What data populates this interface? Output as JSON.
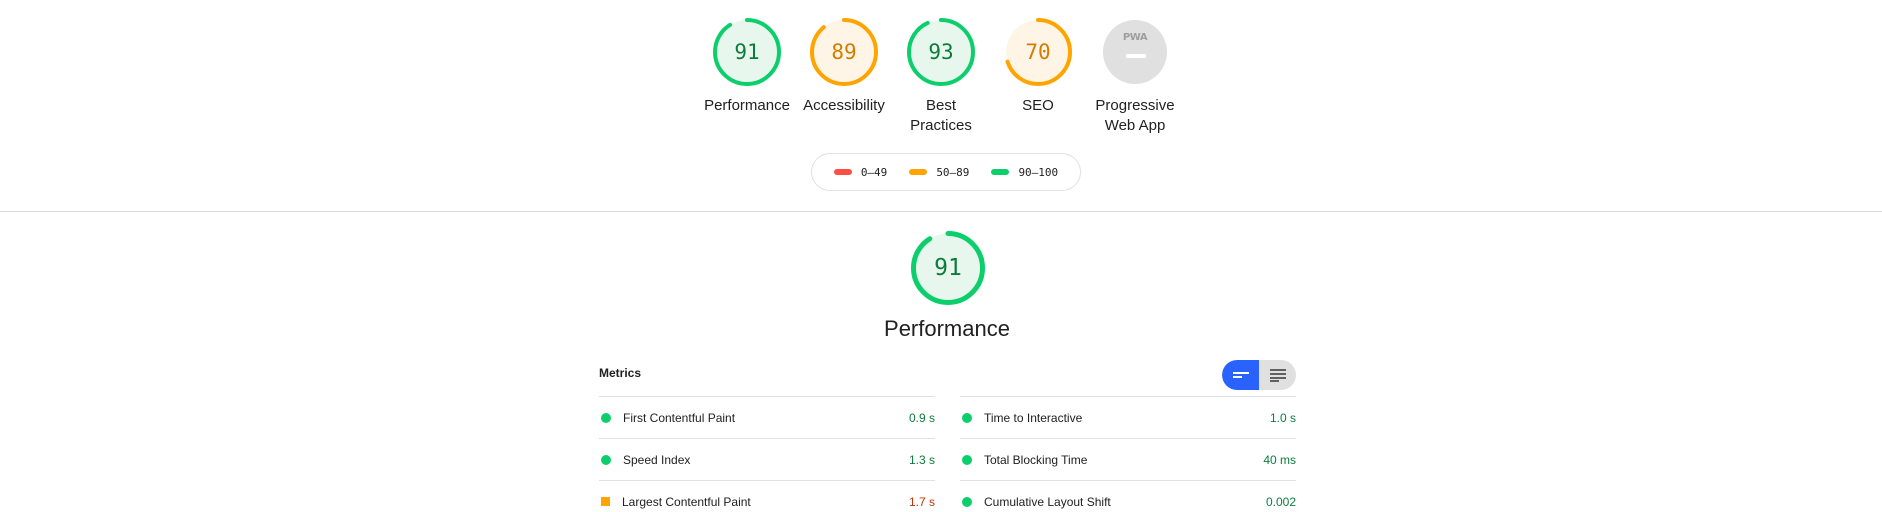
{
  "colors": {
    "pass": "#0cce6b",
    "pass_text": "#0c7c3d",
    "pass_bg": "#e8f7ee",
    "average": "#ffa400",
    "average_text": "#d27c00",
    "average_bg": "#fff5e6",
    "fail": "#ff4e42",
    "accent": "#2962ff",
    "pwa_gray": "#e0e0e0"
  },
  "gauges": [
    {
      "score": "91",
      "label": "Performance",
      "rating": "pass",
      "fraction": 0.91
    },
    {
      "score": "89",
      "label": "Accessibility",
      "rating": "average",
      "fraction": 0.89
    },
    {
      "score": "93",
      "label": "Best\nPractices",
      "rating": "pass",
      "fraction": 0.93
    },
    {
      "score": "70",
      "label": "SEO",
      "rating": "average",
      "fraction": 0.7
    }
  ],
  "pwa": {
    "badge_text": "PWA",
    "label": "Progressive\nWeb App"
  },
  "legend": [
    {
      "range": "0–49",
      "color_key": "fail"
    },
    {
      "range": "50–89",
      "color_key": "average"
    },
    {
      "range": "90–100",
      "color_key": "pass"
    }
  ],
  "performance": {
    "score": "91",
    "fraction": 0.91,
    "title": "Performance"
  },
  "metrics": {
    "header": "Metrics",
    "left": [
      {
        "title": "First Contentful Paint",
        "value": "0.9 s",
        "rating": "pass"
      },
      {
        "title": "Speed Index",
        "value": "1.3 s",
        "rating": "pass"
      },
      {
        "title": "Largest Contentful Paint",
        "value": "1.7 s",
        "rating": "average"
      }
    ],
    "right": [
      {
        "title": "Time to Interactive",
        "value": "1.0 s",
        "rating": "pass"
      },
      {
        "title": "Total Blocking Time",
        "value": "40 ms",
        "rating": "pass"
      },
      {
        "title": "Cumulative Layout Shift",
        "value": "0.002",
        "rating": "pass"
      }
    ]
  },
  "toggle": {
    "active_icon": "compact-view-icon",
    "inactive_icon": "expanded-view-icon"
  }
}
